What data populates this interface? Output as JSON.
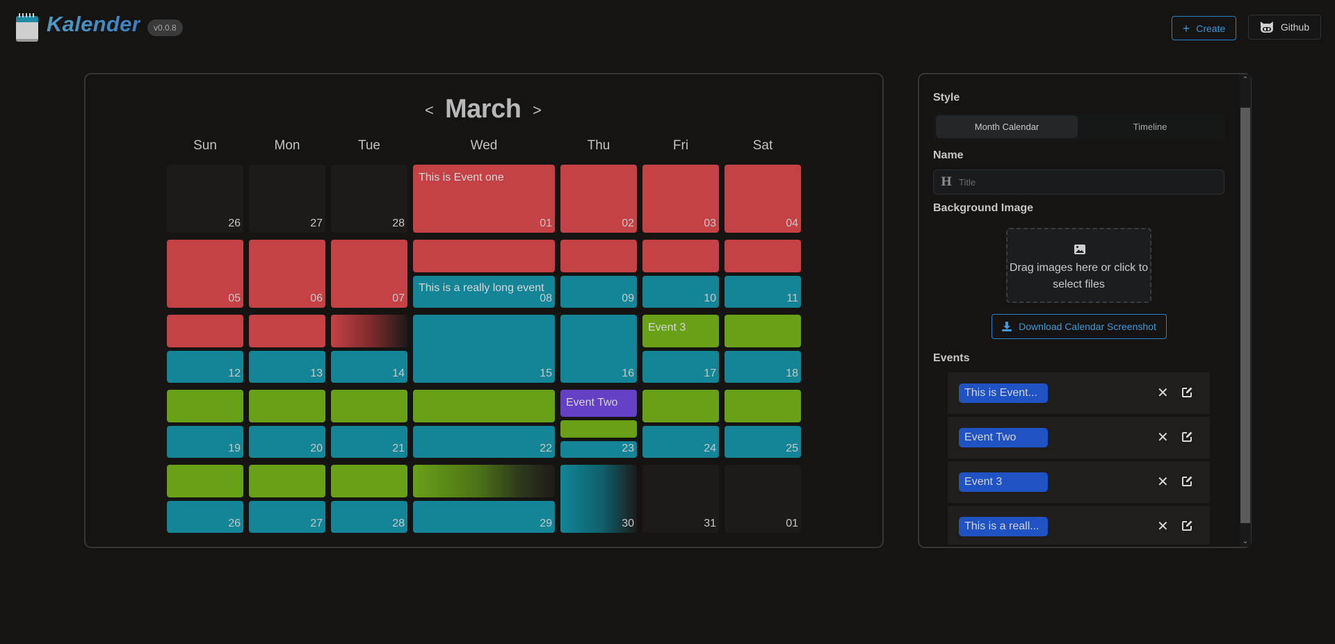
{
  "header": {
    "app_name": "Kalender",
    "version": "v0.0.8",
    "create_label": "Create",
    "github_label": "Github",
    "accent_color": "#2b84c2"
  },
  "calendar": {
    "month": "March",
    "prev_label": "<",
    "next_label": ">",
    "weekdays": [
      "Sun",
      "Mon",
      "Tue",
      "Wed",
      "Thu",
      "Fri",
      "Sat"
    ],
    "weeks": [
      [
        "26",
        "27",
        "28",
        "01",
        "02",
        "03",
        "04"
      ],
      [
        "05",
        "06",
        "07",
        "08",
        "09",
        "10",
        "11"
      ],
      [
        "12",
        "13",
        "14",
        "15",
        "16",
        "17",
        "18"
      ],
      [
        "19",
        "20",
        "21",
        "22",
        "23",
        "24",
        "25"
      ],
      [
        "26",
        "27",
        "28",
        "29",
        "30",
        "31",
        "01"
      ]
    ],
    "event_titles": {
      "event_one": "This is Event one",
      "long_event": "This is a really long event",
      "event_3": "Event 3",
      "event_two": "Event Two"
    },
    "event_colors": {
      "red": "#c44145",
      "teal": "#138597",
      "green": "#68a018",
      "purple": "#6440c4"
    }
  },
  "sidebar": {
    "style_label": "Style",
    "style_options": [
      "Month Calendar",
      "Timeline"
    ],
    "style_selected": "Month Calendar",
    "name_label": "Name",
    "name_placeholder": "Title",
    "name_value": "",
    "bg_label": "Background Image",
    "dropzone_text": "Drag images here or click to select files",
    "download_label": "Download Calendar Screenshot",
    "events_label": "Events",
    "events": [
      {
        "label": "This is Event..."
      },
      {
        "label": "Event Two"
      },
      {
        "label": "Event 3"
      },
      {
        "label": "This is a reall..."
      }
    ]
  }
}
